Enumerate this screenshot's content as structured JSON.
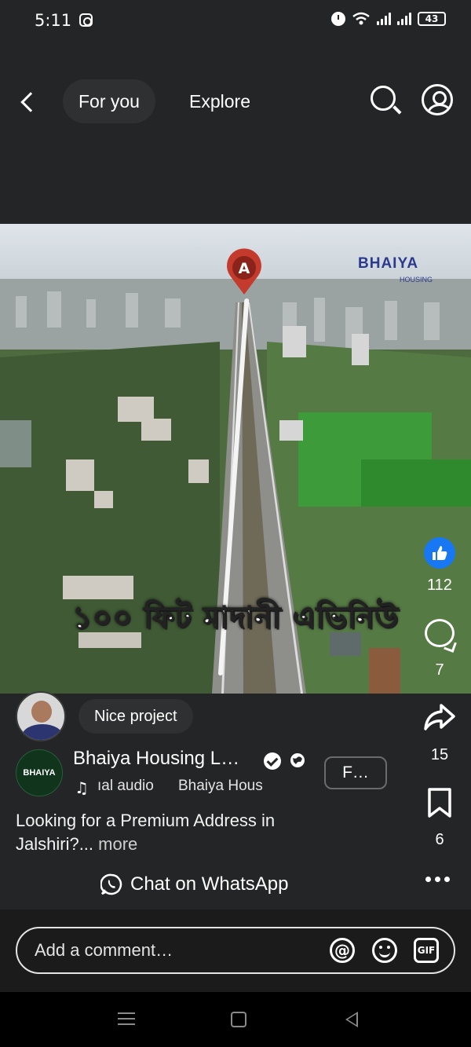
{
  "status_bar": {
    "time": "5:11",
    "battery": "43"
  },
  "nav": {
    "tab_for_you": "For you",
    "tab_explore": "Explore"
  },
  "video": {
    "overlay_text": "১০০ ফিট মাদানী এভিনিউ",
    "brand_logo": "BHAIYA",
    "brand_logo_sub": "HOUSING",
    "pin_label": "A"
  },
  "rail": {
    "likes": "112",
    "comments": "7",
    "shares": "15",
    "saves": "6"
  },
  "comment_preview": {
    "text": "Nice project"
  },
  "page": {
    "name": "Bhaiya Housing L…",
    "logo_text": "BHAIYA",
    "follow_label": "F…",
    "audio_1": "ıal audio",
    "audio_2": "Bhaiya Hous",
    "caption": "Looking for a Premium Address in Jalshiri?...",
    "caption_more": "more"
  },
  "whatsapp": {
    "label": "Chat on WhatsApp"
  },
  "comment_input": {
    "placeholder": "Add a comment…",
    "gif_label": "GIF"
  },
  "colors": {
    "like_blue": "#1877f2",
    "background": "#242526",
    "brand_navy": "#2b3a8f"
  }
}
